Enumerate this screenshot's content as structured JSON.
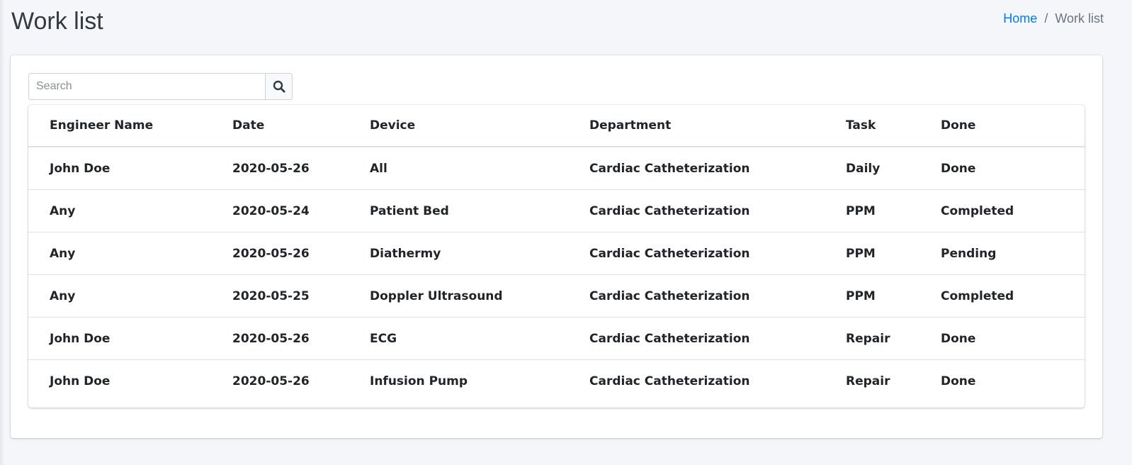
{
  "header": {
    "title": "Work list",
    "breadcrumb": {
      "home": "Home",
      "separator": "/",
      "current": "Work list"
    }
  },
  "search": {
    "placeholder": "Search",
    "value": "",
    "icon": "search-icon"
  },
  "table": {
    "columns": [
      "Engineer Name",
      "Date",
      "Device",
      "Department",
      "Task",
      "Done"
    ],
    "rows": [
      [
        "John Doe",
        "2020-05-26",
        "All",
        "Cardiac Catheterization",
        "Daily",
        "Done"
      ],
      [
        "Any",
        "2020-05-24",
        "Patient Bed",
        "Cardiac Catheterization",
        "PPM",
        "Completed"
      ],
      [
        "Any",
        "2020-05-26",
        "Diathermy",
        "Cardiac Catheterization",
        "PPM",
        "Pending"
      ],
      [
        "Any",
        "2020-05-25",
        "Doppler Ultrasound",
        "Cardiac Catheterization",
        "PPM",
        "Completed"
      ],
      [
        "John Doe",
        "2020-05-26",
        "ECG",
        "Cardiac Catheterization",
        "Repair",
        "Done"
      ],
      [
        "John Doe",
        "2020-05-26",
        "Infusion Pump",
        "Cardiac Catheterization",
        "Repair",
        "Done"
      ]
    ]
  },
  "colors": {
    "background": "#f4f6f9",
    "link": "#007bff",
    "text": "#212529",
    "border": "#dee2e6"
  }
}
